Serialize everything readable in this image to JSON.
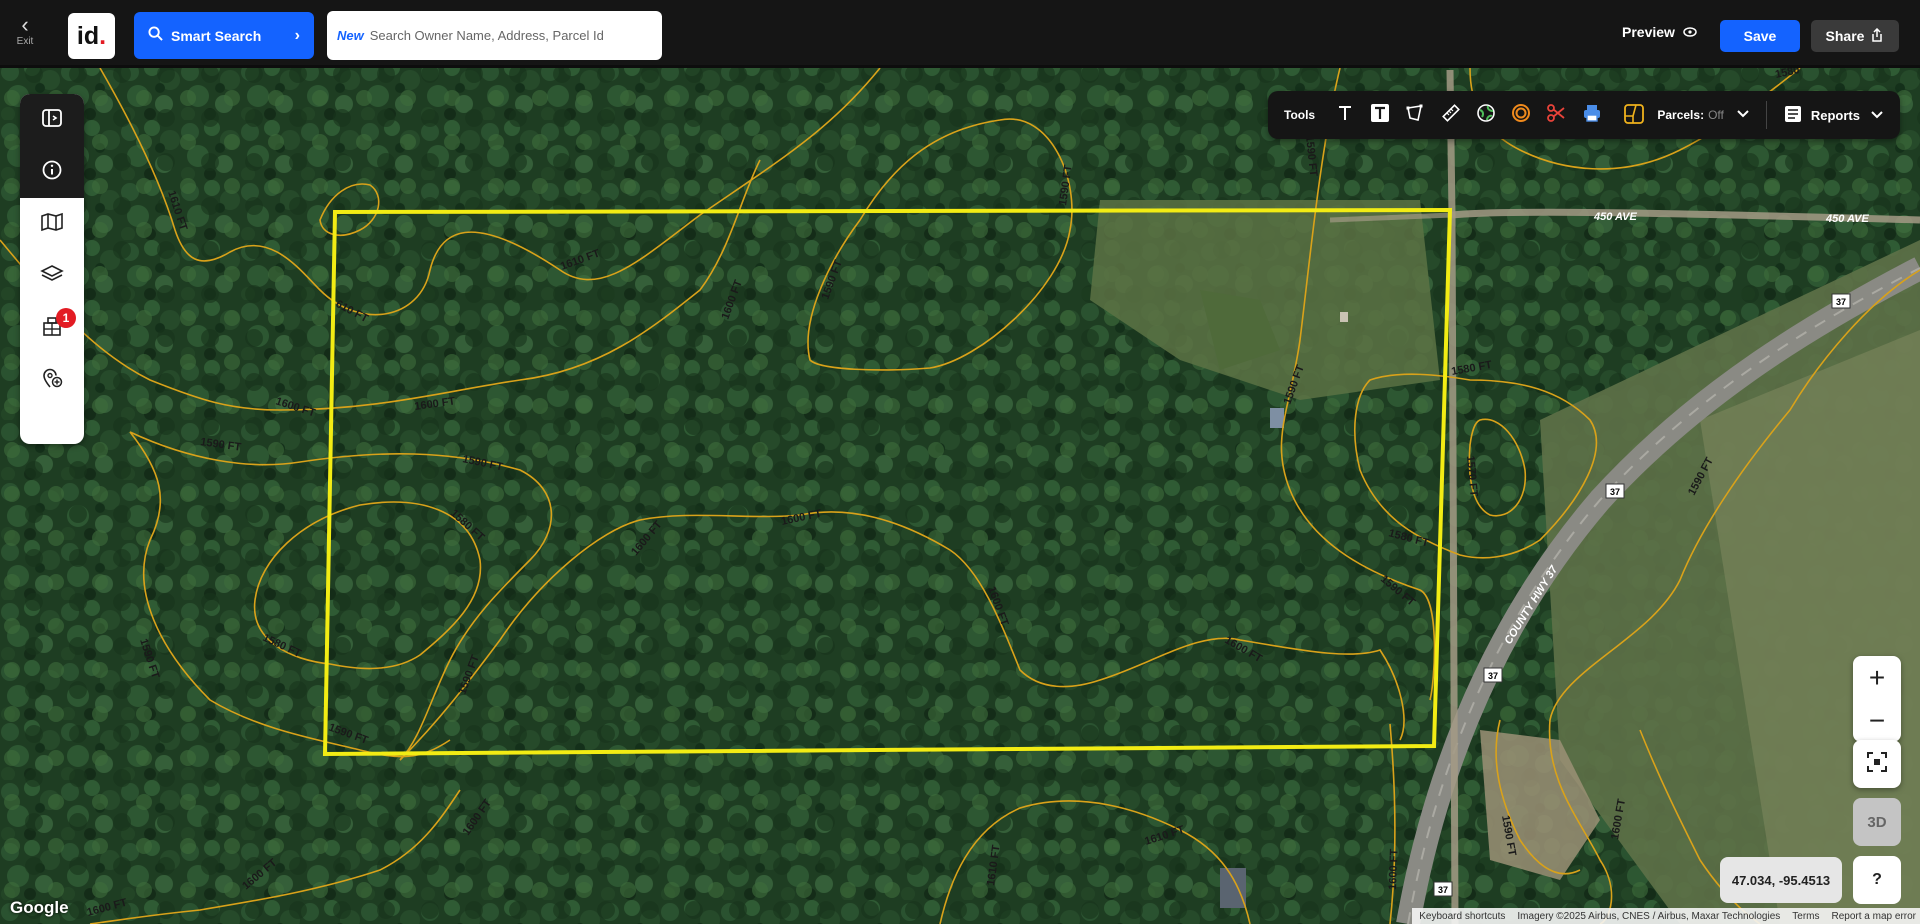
{
  "header": {
    "exit_label": "Exit",
    "logo_text": "id",
    "smart_search_label": "Smart Search",
    "search_badge": "New",
    "search_placeholder": "Search Owner Name, Address, Parcel Id",
    "preview_label": "Preview",
    "save_label": "Save",
    "share_label": "Share"
  },
  "sidebar": {
    "items": [
      {
        "icon": "panel-toggle-icon"
      },
      {
        "icon": "info-icon"
      },
      {
        "icon": "map-icon"
      },
      {
        "icon": "layers-icon"
      },
      {
        "icon": "buildings-icon",
        "badge": "1"
      },
      {
        "icon": "add-location-icon"
      }
    ]
  },
  "toolbar": {
    "tools_label": "Tools",
    "tools": [
      "text-icon",
      "text-box-icon",
      "polygon-draw-icon",
      "ruler-icon",
      "globe-icon",
      "target-icon",
      "scissors-icon",
      "printer-icon",
      "parcel-shape-icon"
    ],
    "parcels_label": "Parcels:",
    "parcels_state": "Off",
    "reports_label": "Reports"
  },
  "map": {
    "contour_labels": [
      {
        "text": "1610 FT"
      },
      {
        "text": "610 FT"
      },
      {
        "text": "1610 FT"
      },
      {
        "text": "1600 FT"
      },
      {
        "text": "1600 FT"
      },
      {
        "text": "1600 FT"
      },
      {
        "text": "1590 FT"
      },
      {
        "text": "1590 FT"
      },
      {
        "text": "1580 FT"
      },
      {
        "text": "1580 FT"
      },
      {
        "text": "1590 FT"
      },
      {
        "text": "1590 FT"
      },
      {
        "text": "1590 FT"
      },
      {
        "text": "1600 FT"
      },
      {
        "text": "1600 FT"
      },
      {
        "text": "1600 FT"
      },
      {
        "text": "1600 FT"
      },
      {
        "text": "1590 FT"
      },
      {
        "text": "1590 FT"
      },
      {
        "text": "1590 FT"
      },
      {
        "text": "1580 FT"
      },
      {
        "text": "1570 FT"
      },
      {
        "text": "1580 FT"
      },
      {
        "text": "1590 FT"
      },
      {
        "text": "1590 FT"
      },
      {
        "text": "1600 FT"
      },
      {
        "text": "1600 FT"
      },
      {
        "text": "1610 FT"
      },
      {
        "text": "1610 FT"
      },
      {
        "text": "1600 FT"
      },
      {
        "text": "1600 FT"
      },
      {
        "text": "1590 FT"
      },
      {
        "text": "1600 FT"
      },
      {
        "text": "1590 FT"
      },
      {
        "text": "1580"
      }
    ],
    "road_labels": [
      "450 AVE",
      "450 AVE",
      "COUNTY HWY 37"
    ],
    "shields": [
      "37",
      "37",
      "37",
      "37"
    ],
    "coordinates": "47.034, -95.4513",
    "btn_3d": "3D",
    "help": "?",
    "google": "Google",
    "attribution": {
      "shortcuts": "Keyboard shortcuts",
      "imagery": "Imagery ©2025 Airbus, CNES / Airbus, Maxar Technologies",
      "terms": "Terms",
      "report": "Report a map error"
    }
  }
}
